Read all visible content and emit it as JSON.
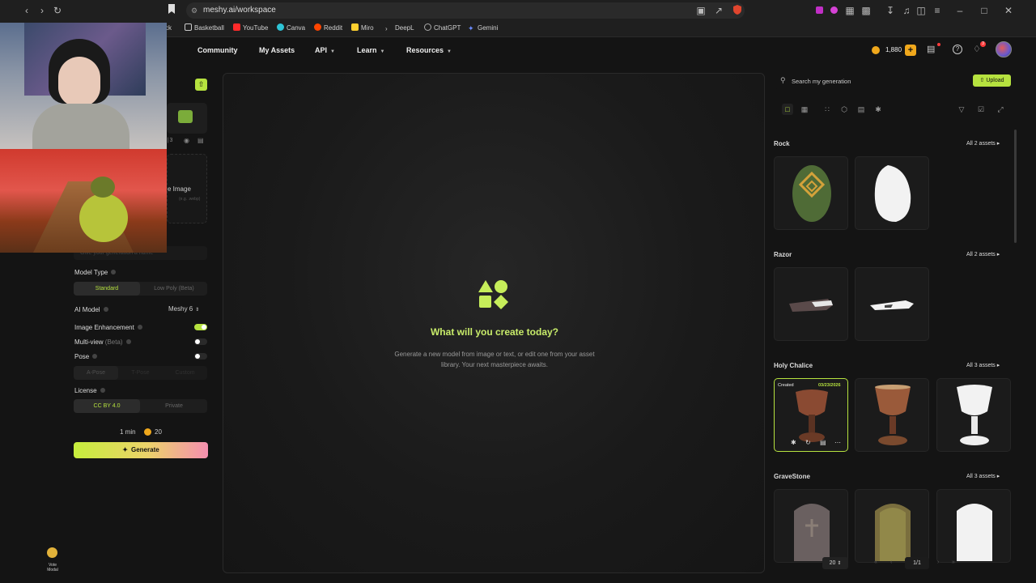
{
  "browser": {
    "url": "meshy.ai/workspace",
    "bookmarks": [
      {
        "label": "ck",
        "color": "#8a8a8a"
      },
      {
        "label": "Basketball",
        "color": "#cccccc"
      },
      {
        "label": "YouTube",
        "color": "#ff2a2a"
      },
      {
        "label": "Canva",
        "color": "#2ec4d6"
      },
      {
        "label": "Reddit",
        "color": "#ff4500"
      },
      {
        "label": "Miro",
        "color": "#ffd02f"
      },
      {
        "label": "DeepL",
        "color": "#0f2b46"
      },
      {
        "label": "ChatGPT",
        "color": "#aaaaaa"
      },
      {
        "label": "Gemini",
        "color": "#6b8cff"
      }
    ]
  },
  "header": {
    "nav": [
      {
        "label": "Community",
        "caret": false
      },
      {
        "label": "My Assets",
        "caret": false
      },
      {
        "label": "API",
        "caret": true
      },
      {
        "label": "Learn",
        "caret": true
      },
      {
        "label": "Resources",
        "caret": true
      }
    ],
    "credits": "1,880",
    "notification_count": "3"
  },
  "left": {
    "upload_partial": "e Image",
    "upload_hint": "(e.g. .webp)",
    "name_placeholder": "Give your generation a name",
    "model_type_label": "Model Type",
    "model_type_options": [
      "Standard",
      "Low Poly (Beta)"
    ],
    "model_type_selected": "Standard",
    "ai_model_label": "AI Model",
    "ai_model_value": "Meshy 6",
    "image_enhancement_label": "Image Enhancement",
    "image_enhancement_on": true,
    "multiview_label": "Multi-view",
    "multiview_beta": "(Beta)",
    "multiview_on": false,
    "pose_label": "Pose",
    "pose_on": false,
    "pose_options": [
      "A-Pose",
      "T-Pose",
      "Custom"
    ],
    "license_label": "License",
    "license_options": [
      "CC BY 4.0",
      "Private"
    ],
    "license_selected": "CC BY 4.0",
    "time_estimate": "1 min",
    "credit_cost": "20",
    "generate_label": "Generate",
    "vote_label_1": "Vote",
    "vote_label_2": "Modal"
  },
  "center": {
    "title": "What will you create today?",
    "subtitle_1": "Generate a new model from image or text, or edit one from your asset",
    "subtitle_2": "library. Your next masterpiece awaits."
  },
  "right": {
    "search_placeholder": "Search my generation",
    "upload_label": "Upload",
    "groups": [
      {
        "name": "Rock",
        "count": "All 2 assets"
      },
      {
        "name": "Razor",
        "count": "All 2 assets"
      },
      {
        "name": "Holy Chalice",
        "count": "All 3 assets"
      },
      {
        "name": "GraveStone",
        "count": "All 3 assets"
      }
    ],
    "created_tag": "Created",
    "created_date": "03/23/2026",
    "page_size": "20",
    "page_indicator": "1/1"
  },
  "colors": {
    "accent": "#b6e23f",
    "background": "#141414",
    "panel": "#1e1e1e",
    "coin": "#f0a81c"
  }
}
